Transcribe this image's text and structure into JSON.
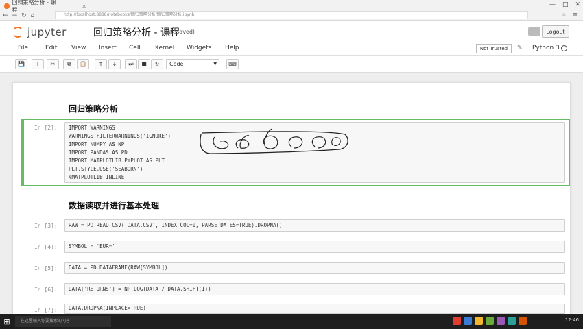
{
  "browser": {
    "tab_title": "回归策略分析 - 课程",
    "address": "http://localhost:8888/notebooks/回归策略分析/回归策略分析.ipynb",
    "win_controls": [
      "—",
      "□",
      "✕"
    ]
  },
  "header": {
    "logo_text": "jupyter",
    "notebook_title": "回归策略分析 - 课程",
    "autosaved": "(autosaved)",
    "logout": "Logout"
  },
  "menubar": {
    "items": [
      "File",
      "Edit",
      "View",
      "Insert",
      "Cell",
      "Kernel",
      "Widgets",
      "Help"
    ],
    "not_trusted": "Not Trusted",
    "kernel": "Python 3"
  },
  "toolbar": {
    "buttons": [
      "💾",
      "+",
      "✂",
      "⧉",
      "📋",
      "↑",
      "↓",
      "⏭",
      "■",
      "↻"
    ],
    "cell_type": "Code",
    "keyboard": "⌨"
  },
  "notebook": {
    "heading1": "回归策略分析",
    "heading2": "数据读取并进行基本处理",
    "cell1_prompt": "In [2]:",
    "cell1_lines": [
      "IMPORT WARNINGS",
      "WARNINGS.FILTERWARNINGS('IGNORE')",
      "IMPORT NUMPY AS NP",
      "IMPORT PANDAS AS PD",
      "IMPORT MATPLOTLIB.PYPLOT AS PLT",
      "PLT.STYLE.USE('SEABORN')",
      "%MATPLOTLIB INLINE"
    ],
    "cells": [
      {
        "prompt": "In [3]:",
        "code": "RAW = PD.READ_CSV('DATA.CSV', INDEX_COL=0, PARSE_DATES=TRUE).DROPNA()"
      },
      {
        "prompt": "In [4]:",
        "code": "SYMBOL = 'EUR='"
      },
      {
        "prompt": "In [5]:",
        "code": "DATA = PD.DATAFRAME(RAW[SYMBOL])"
      },
      {
        "prompt": "In [6]:",
        "code": "DATA['RETURNS'] = NP.LOG(DATA / DATA.SHIFT(1))"
      },
      {
        "prompt": "In [7]:",
        "code": "DATA.DROPNA(INPLACE=TRUE)"
      }
    ]
  },
  "taskbar": {
    "search": "在这里输入你要搜索的内容",
    "clock": "12:46",
    "icon_colors": [
      "#e03c31",
      "#3a7bd5",
      "#f2b632",
      "#6aaa3a",
      "#9b59b6",
      "#2aa198",
      "#d35400"
    ]
  }
}
